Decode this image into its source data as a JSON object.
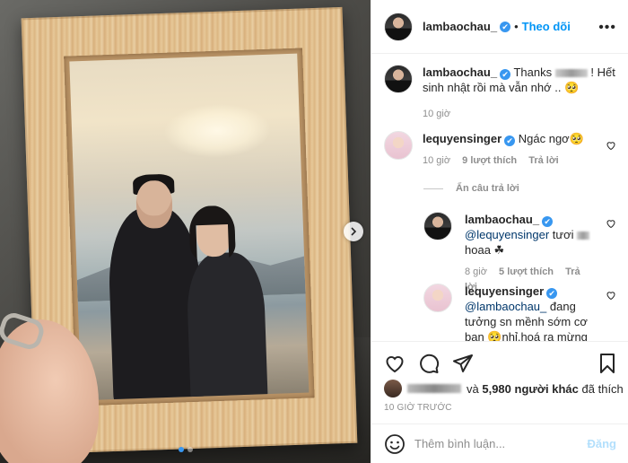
{
  "post": {
    "author": "lambaochau_",
    "follow_label": "Theo dõi",
    "separator": "•",
    "more_label": "•••",
    "verified_mark": "✔"
  },
  "comments": [
    {
      "user": "lambaochau_",
      "text_before": "Thanks",
      "text_after": "! Hết sinh nhật rồi mà vẫn nhớ .. 🥺",
      "time": "10 giờ"
    },
    {
      "user": "lequyensinger",
      "text": "Ngác ngơ🥺",
      "time": "10 giờ",
      "likes": "9 lượt thích",
      "reply_label": "Trả lời",
      "hide_replies": "Ẩn câu trả lời"
    },
    {
      "user": "lambaochau_",
      "mention": "@lequyensinger",
      "text_before": "tươi",
      "text_after": "hoaa ☘",
      "time": "8 giờ",
      "likes": "5 lượt thích",
      "reply_label": "Trả lời"
    },
    {
      "user": "lequyensinger",
      "mention": "@lambaochau_",
      "text": "đang tưởng sn mềnh sớm cơ bạn 🥺nhỉ,hoá ra mừng sn",
      "time": "",
      "likes": "",
      "reply_label": ""
    }
  ],
  "likes": {
    "and_label": "và",
    "others": "5,980 người khác",
    "suffix": "đã thích"
  },
  "timestamp": "10 GIỜ TRƯỚC",
  "add_comment": {
    "placeholder": "Thêm bình luận...",
    "post_label": "Đăng"
  },
  "icons": {
    "like": "heart-icon",
    "comment": "comment-icon",
    "share": "share-icon",
    "save": "bookmark-icon",
    "emoji": "emoji-icon",
    "next": "chevron-right-icon"
  },
  "colors": {
    "accent": "#0095f6",
    "verified": "#3897f0",
    "muted": "#8e8e8e",
    "post_disabled": "#b2dffc"
  }
}
